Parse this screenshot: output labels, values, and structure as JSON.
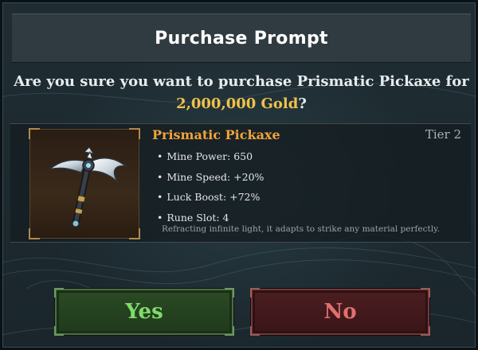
{
  "dialog": {
    "title": "Purchase Prompt",
    "question_prefix": "Are you sure you want to purchase Prismatic Pickaxe for",
    "price": "2,000,000 Gold",
    "question_suffix": "?"
  },
  "item": {
    "name": "Prismatic Pickaxe",
    "tier": "Tier 2",
    "icon": "pickaxe-icon",
    "stats": [
      {
        "label": "Mine Power",
        "value": "650"
      },
      {
        "label": "Mine Speed",
        "value": "+20%"
      },
      {
        "label": "Luck Boost",
        "value": "+72%"
      },
      {
        "label": "Rune Slot",
        "value": "4"
      }
    ],
    "stat_text": [
      "Mine Power: 650",
      "Mine Speed: +20%",
      "Luck Boost: +72%",
      "Rune Slot: 4"
    ],
    "description": "Refracting infinite light, it adapts to strike any material perfectly."
  },
  "buttons": {
    "yes_label": "Yes",
    "no_label": "No"
  },
  "colors": {
    "price": "#f0c24b",
    "item_name": "#f2a33a",
    "yes": "#7fdc6a",
    "no": "#e2706c"
  }
}
